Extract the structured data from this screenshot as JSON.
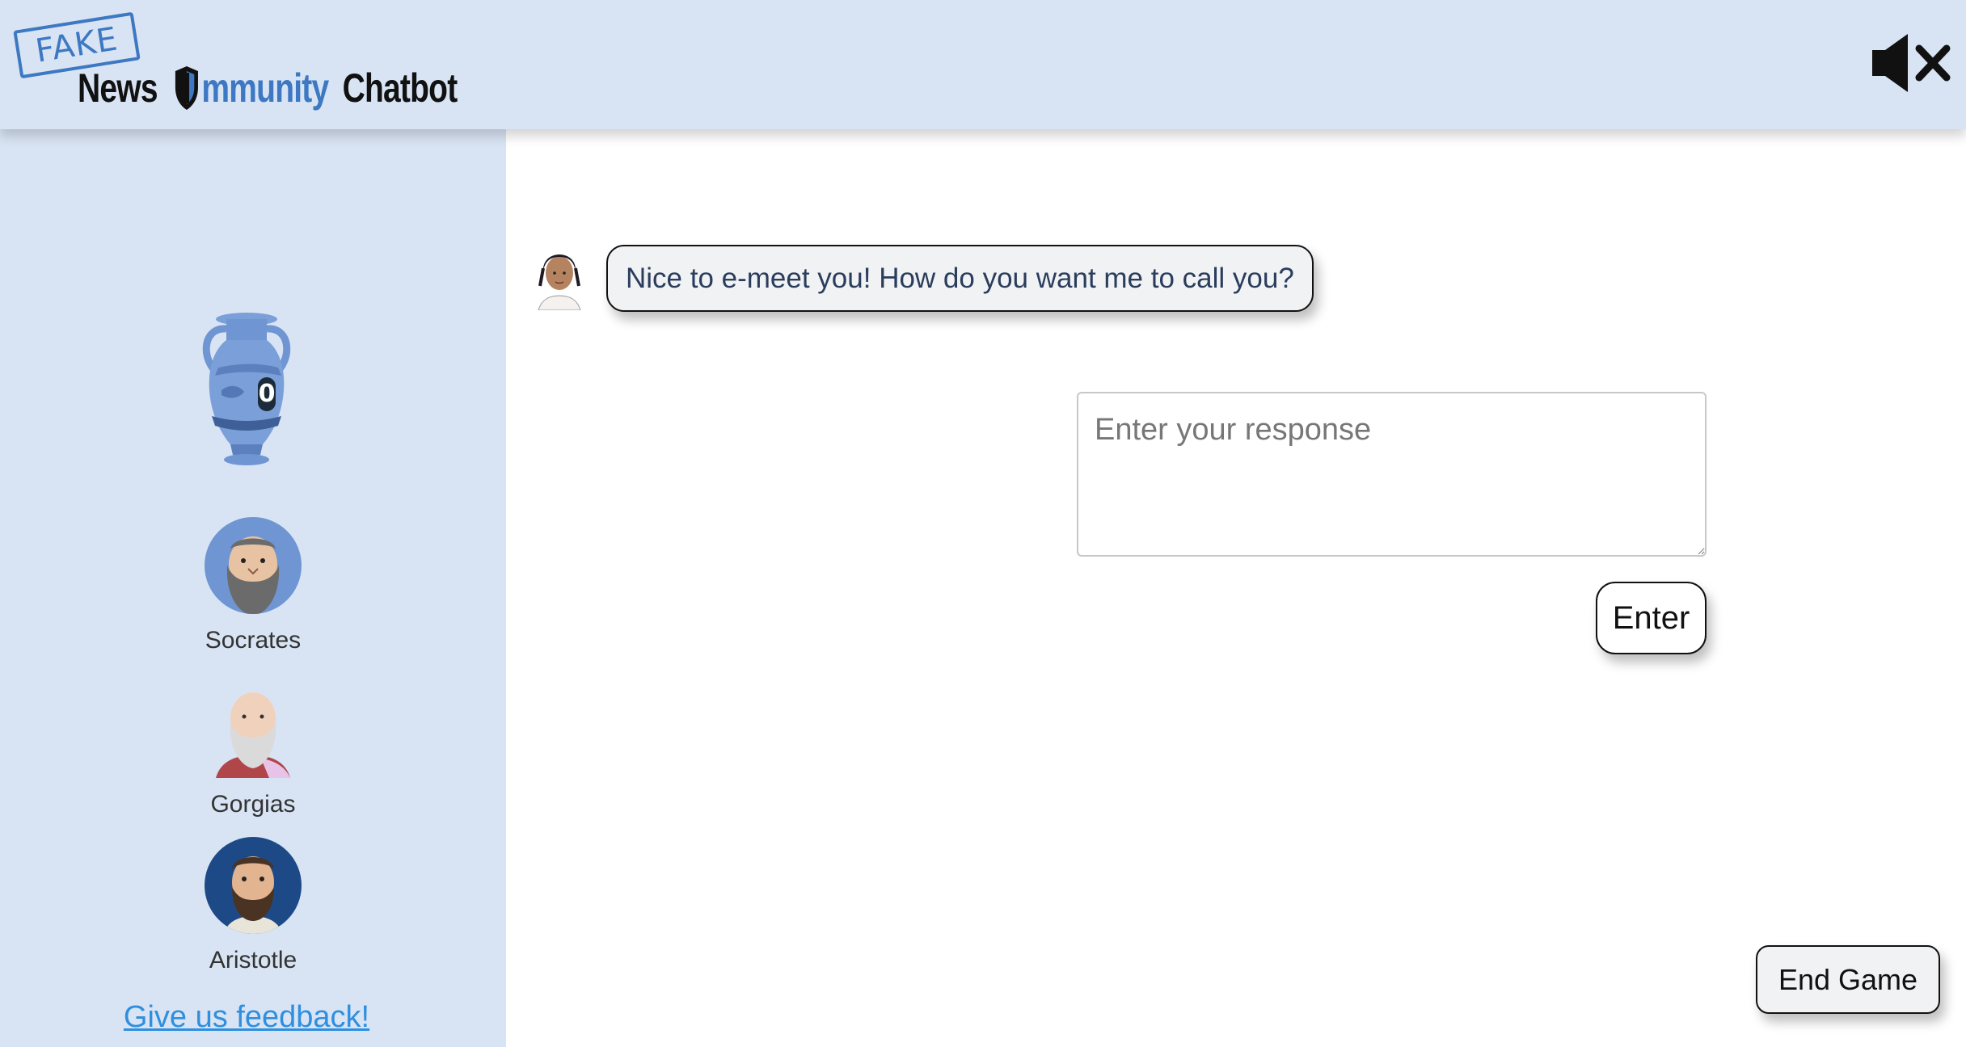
{
  "header": {
    "logo": {
      "stamp_text": "FAKE",
      "word_news": "News",
      "word_immunity": "mmunity",
      "word_chatbot": "Chatbot"
    },
    "mute_icon": "speaker-muted-icon"
  },
  "sidebar": {
    "vase_icon": "amphora-vase-icon",
    "vase_score": "0",
    "characters": [
      {
        "name": "Socrates",
        "avatar": "socrates-avatar"
      },
      {
        "name": "Gorgias",
        "avatar": "gorgias-avatar"
      },
      {
        "name": "Aristotle",
        "avatar": "aristotle-avatar"
      }
    ],
    "feedback_link": "Give us feedback!"
  },
  "chat": {
    "bot_avatar": "chatbot-avatar",
    "messages": [
      {
        "from": "bot",
        "text": "Nice to e-meet you! How do you want me to call you?"
      }
    ],
    "input": {
      "value": "",
      "placeholder": "Enter your response"
    },
    "enter_button": "Enter"
  },
  "end_game_button": "End Game",
  "colors": {
    "panel_bg": "#d8e4f4",
    "brand_blue": "#3d78c2",
    "link_blue": "#2f8fde",
    "bubble_bg": "#f1f2f4",
    "bubble_text": "#2a3d5c"
  }
}
